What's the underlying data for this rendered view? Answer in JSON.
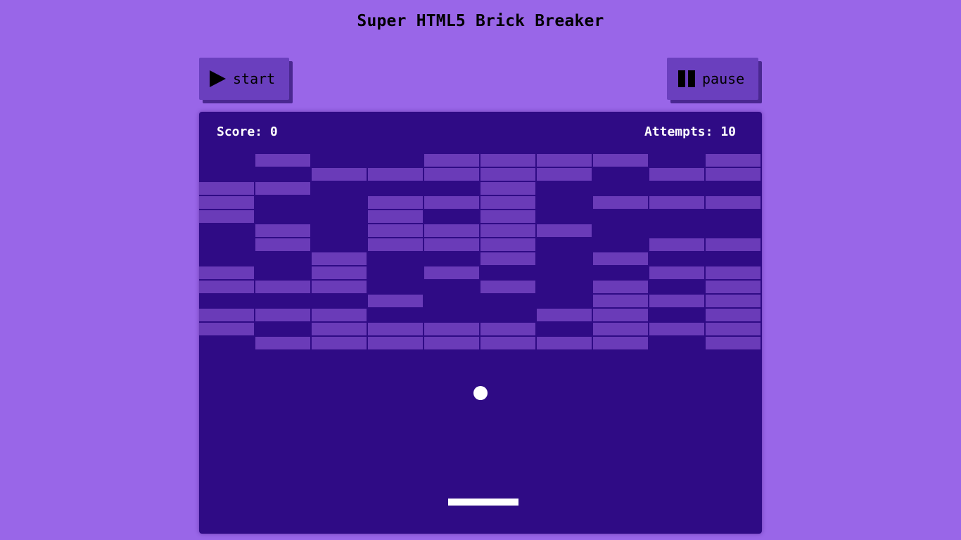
{
  "page": {
    "title": "Super HTML5 Brick Breaker"
  },
  "controls": {
    "start_label": "start",
    "pause_label": "pause"
  },
  "hud": {
    "score_text": "Score: 0",
    "attempts_text": "Attempts: 10"
  },
  "colors": {
    "page_background": "#9966e8",
    "board_background": "#2f0b85",
    "brick": "#6a3bb8",
    "button": "#6a3fbe",
    "ball": "#ffffff",
    "paddle": "#ffffff"
  },
  "bricks": {
    "rows": [
      [
        0,
        1,
        0,
        0,
        1,
        1,
        1,
        1,
        0,
        1
      ],
      [
        0,
        0,
        1,
        1,
        1,
        1,
        1,
        0,
        1,
        1
      ],
      [
        1,
        1,
        0,
        0,
        0,
        1,
        0,
        0,
        0,
        0
      ],
      [
        1,
        0,
        0,
        1,
        1,
        1,
        0,
        1,
        1,
        1
      ],
      [
        1,
        0,
        0,
        1,
        0,
        1,
        0,
        0,
        0,
        0
      ],
      [
        0,
        1,
        0,
        1,
        1,
        1,
        1,
        0,
        0,
        0
      ],
      [
        0,
        1,
        0,
        1,
        1,
        1,
        0,
        0,
        1,
        1
      ],
      [
        0,
        0,
        1,
        0,
        0,
        1,
        0,
        1,
        0,
        0
      ],
      [
        1,
        0,
        1,
        0,
        1,
        0,
        0,
        0,
        1,
        1
      ],
      [
        1,
        1,
        1,
        0,
        0,
        1,
        0,
        1,
        0,
        1
      ],
      [
        0,
        0,
        0,
        1,
        0,
        0,
        0,
        1,
        1,
        1
      ],
      [
        1,
        1,
        1,
        0,
        0,
        0,
        1,
        1,
        0,
        1
      ],
      [
        1,
        0,
        1,
        1,
        1,
        1,
        0,
        1,
        1,
        1
      ],
      [
        0,
        1,
        1,
        1,
        1,
        1,
        1,
        1,
        0,
        1
      ]
    ]
  }
}
